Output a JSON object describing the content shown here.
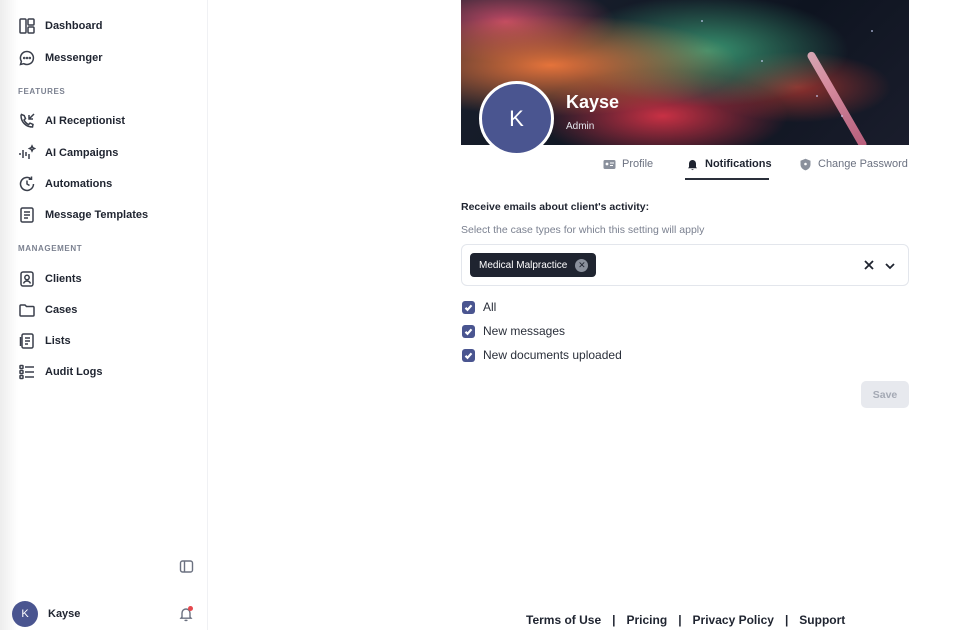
{
  "sidebar": {
    "items_top": [
      {
        "label": "Dashboard",
        "icon": "dashboard-icon"
      },
      {
        "label": "Messenger",
        "icon": "chat-bubble-icon"
      }
    ],
    "features_label": "FEATURES",
    "features": [
      {
        "label": "AI Receptionist",
        "icon": "phone-incoming-icon"
      },
      {
        "label": "AI Campaigns",
        "icon": "sparkle-bars-icon"
      },
      {
        "label": "Automations",
        "icon": "clock-refresh-icon"
      },
      {
        "label": "Message Templates",
        "icon": "document-list-icon"
      }
    ],
    "management_label": "MANAGEMENT",
    "management": [
      {
        "label": "Clients",
        "icon": "user-square-icon"
      },
      {
        "label": "Cases",
        "icon": "folder-icon"
      },
      {
        "label": "Lists",
        "icon": "clipboard-list-icon"
      },
      {
        "label": "Audit Logs",
        "icon": "list-bullet-icon"
      }
    ],
    "user": {
      "initial": "K",
      "name": "Kayse"
    }
  },
  "profile": {
    "initial": "K",
    "name": "Kayse",
    "role": "Admin"
  },
  "tabs": [
    {
      "label": "Profile",
      "icon": "id-card-icon",
      "active": false
    },
    {
      "label": "Notifications",
      "icon": "bell-icon",
      "active": true
    },
    {
      "label": "Change Password",
      "icon": "shield-icon",
      "active": false
    }
  ],
  "form": {
    "heading": "Receive emails about client's activity:",
    "subheading": "Select the case types for which this setting will apply",
    "selected_chip": "Medical Malpractice",
    "checkboxes": [
      {
        "label": "All",
        "checked": true
      },
      {
        "label": "New messages",
        "checked": true
      },
      {
        "label": "New documents uploaded",
        "checked": true
      }
    ],
    "save_label": "Save"
  },
  "footer": {
    "links": [
      "Terms of Use",
      "Pricing",
      "Privacy Policy",
      "Support"
    ],
    "separator": "|"
  },
  "colors": {
    "accent": "#4a5590",
    "dark": "#1f2430",
    "muted": "#7b8190"
  }
}
